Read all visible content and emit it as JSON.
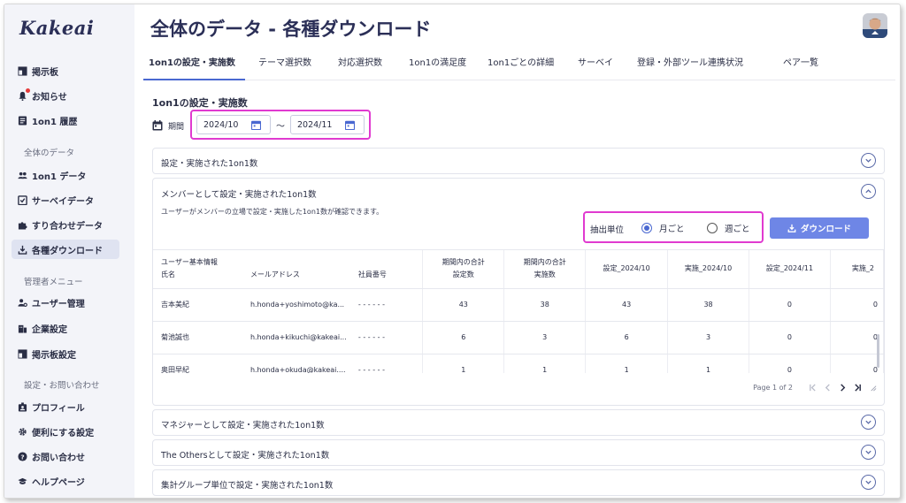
{
  "app": {
    "logo": "Kakeai",
    "page_title": "全体のデータ - 各種ダウンロード"
  },
  "sidebar": {
    "items_top": [
      {
        "label": "掲示板",
        "icon": "board-icon"
      },
      {
        "label": "お知らせ",
        "icon": "bell-icon"
      },
      {
        "label": "1on1 履歴",
        "icon": "history-icon"
      }
    ],
    "section_data": "全体のデータ",
    "items_data": [
      {
        "label": "1on1 データ",
        "icon": "people-icon"
      },
      {
        "label": "サーベイデータ",
        "icon": "survey-icon"
      },
      {
        "label": "すり合わせデータ",
        "icon": "puzzle-icon"
      },
      {
        "label": "各種ダウンロード",
        "icon": "download-icon"
      }
    ],
    "section_admin": "管理者メニュー",
    "items_admin": [
      {
        "label": "ユーザー管理",
        "icon": "user-manage-icon"
      },
      {
        "label": "企業設定",
        "icon": "company-icon"
      },
      {
        "label": "掲示板設定",
        "icon": "board-settings-icon"
      }
    ],
    "section_settings": "設定・お問い合わせ",
    "items_settings": [
      {
        "label": "プロフィール",
        "icon": "profile-icon"
      },
      {
        "label": "便利にする設定",
        "icon": "gear-icon"
      },
      {
        "label": "お問い合わせ",
        "icon": "help-icon"
      },
      {
        "label": "ヘルプページ",
        "icon": "graduation-icon"
      }
    ]
  },
  "tabs": [
    "1on1の設定・実施数",
    "テーマ選択数",
    "対応選択数",
    "1on1の満足度",
    "1on1ごとの詳細",
    "サーベイ",
    "登録・外部ツール連携状況",
    "ペア一覧"
  ],
  "section": {
    "title": "1on1の設定・実施数",
    "period_label": "期間",
    "date_from": "2024/10",
    "date_sep": "〜",
    "date_to": "2024/11"
  },
  "accordions": {
    "a1": "設定・実施された1on1数",
    "a2": "メンバーとして設定・実施された1on1数",
    "a2_desc": "ユーザーがメンバーの立場で設定・実施した1on1数が確認できます。",
    "a3": "マネジャーとして設定・実施された1on1数",
    "a4": "The Othersとして設定・実施された1on1数",
    "a5": "集計グループ単位で設定・実施された1on1数"
  },
  "extract": {
    "label": "抽出単位",
    "monthly": "月ごと",
    "weekly": "週ごと",
    "selected": "monthly",
    "download": "ダウンロード"
  },
  "table": {
    "group_header": "ユーザー基本情報",
    "headers": [
      "氏名",
      "メールアドレス",
      "社員番号",
      "期間内の合計設定数",
      "期間内の合計実施数",
      "設定_2024/10",
      "実施_2024/10",
      "設定_2024/11",
      "実施_2"
    ],
    "rows": [
      [
        "吉本美紀",
        "h.honda+yoshimoto@ka...",
        "- - - - - -",
        "43",
        "38",
        "43",
        "38",
        "0",
        "0"
      ],
      [
        "菊池誠也",
        "h.honda+kikuchi@kakeai...",
        "- - - - - -",
        "6",
        "3",
        "6",
        "3",
        "0",
        "0"
      ],
      [
        "奥田早紀",
        "h.honda+okuda@kakeai....",
        "- - - - - -",
        "1",
        "1",
        "1",
        "1",
        "0",
        "0"
      ]
    ],
    "pager": "Page 1 of 2"
  },
  "colors": {
    "accent": "#4a68d1",
    "highlight": "#e03ad0",
    "button": "#6e86e6"
  }
}
